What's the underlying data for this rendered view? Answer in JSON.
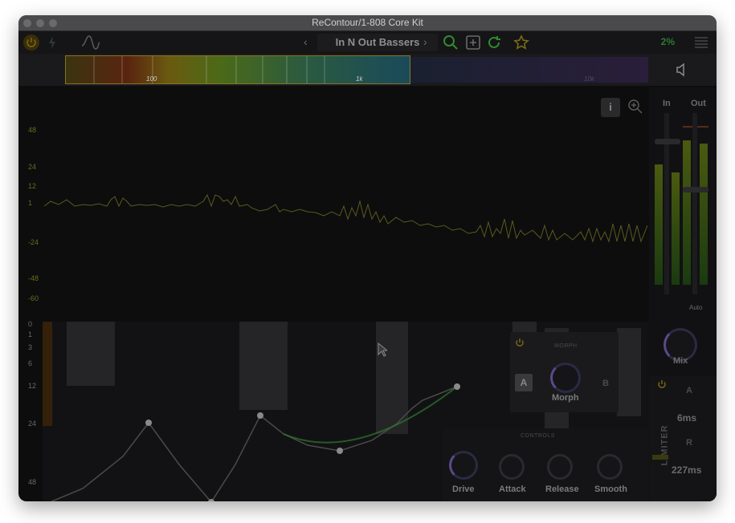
{
  "window": {
    "title": "ReContour/1-808 Core Kit"
  },
  "toolbar": {
    "preset_name": "In N Out Bassers",
    "prev_glyph": "‹",
    "next_glyph": "›",
    "cpu_percent": "2%"
  },
  "spectrum_strip": {
    "ticks": [
      "100",
      "1k",
      "10k"
    ]
  },
  "graph": {
    "top_scale": [
      "48",
      "24",
      "12",
      "1",
      "-24",
      "-48",
      "-60"
    ],
    "bottom_scale": [
      "0",
      "1",
      "3",
      "6",
      "12",
      "24",
      "48",
      "60"
    ]
  },
  "meters": {
    "in_label": "In",
    "out_label": "Out",
    "auto_label": "Auto",
    "mix_label": "Mix"
  },
  "morph": {
    "title": "MORPH",
    "a_label": "A",
    "b_label": "B",
    "knob_label": "Morph"
  },
  "controls": {
    "title": "CONTROLS",
    "drive": "Drive",
    "attack": "Attack",
    "release": "Release",
    "smooth": "Smooth"
  },
  "limiter": {
    "label": "LIMITER",
    "a_label": "A",
    "attack_value": "6ms",
    "r_label": "R",
    "release_value": "227ms"
  },
  "icons": [
    "power-icon",
    "bolt-icon",
    "wave-icon",
    "search-icon",
    "add-icon",
    "refresh-icon",
    "star-icon",
    "menu-icon",
    "speaker-icon",
    "info-icon",
    "zoom-icon",
    "cursor-icon"
  ],
  "colors": {
    "accent_green": "#2e8b2e",
    "accent_yellow": "#8a7420"
  }
}
